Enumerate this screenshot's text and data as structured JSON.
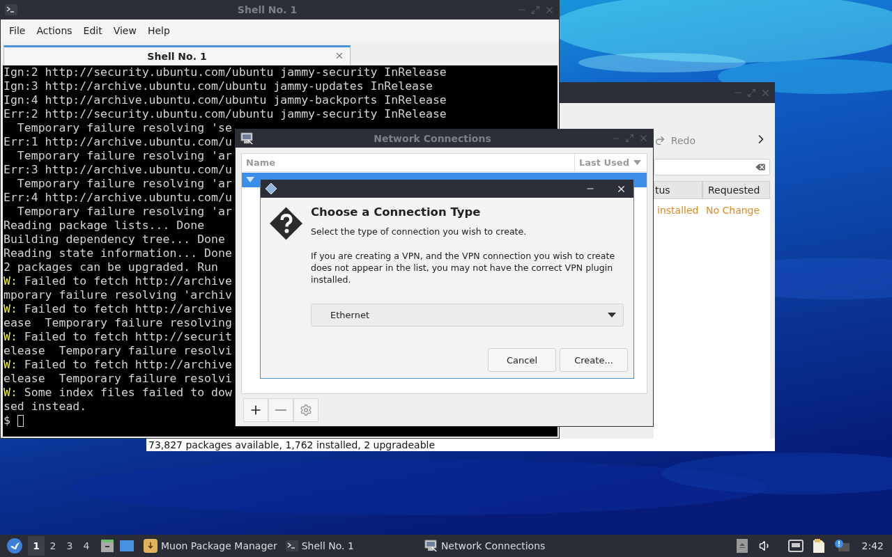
{
  "terminal": {
    "title": "Shell No. 1",
    "menu": [
      "File",
      "Actions",
      "Edit",
      "View",
      "Help"
    ],
    "tabs": [
      {
        "label": "Shell No. 1",
        "selected": true
      }
    ],
    "lines": [
      {
        "text": "Ign:2 http://security.ubuntu.com/ubuntu jammy-security InRelease"
      },
      {
        "text": "Ign:3 http://archive.ubuntu.com/ubuntu jammy-updates InRelease"
      },
      {
        "text": "Ign:4 http://archive.ubuntu.com/ubuntu jammy-backports InRelease"
      },
      {
        "text": "Err:2 http://security.ubuntu.com/ubuntu jammy-security InRelease"
      },
      {
        "text": "  Temporary failure resolving 'se"
      },
      {
        "text": "Err:1 http://archive.ubuntu.com/u"
      },
      {
        "text": "  Temporary failure resolving 'ar"
      },
      {
        "text": "Err:3 http://archive.ubuntu.com/u"
      },
      {
        "text": "  Temporary failure resolving 'ar"
      },
      {
        "text": "Err:4 http://archive.ubuntu.com/u"
      },
      {
        "text": "  Temporary failure resolving 'ar"
      },
      {
        "text": "Reading package lists... Done"
      },
      {
        "text": "Building dependency tree... Done"
      },
      {
        "text": "Reading state information... Done"
      },
      {
        "text": "2 packages can be upgraded. Run"
      },
      {
        "tag": "W:",
        "text": " Failed to fetch http://archive"
      },
      {
        "text": "mporary failure resolving 'archiv"
      },
      {
        "tag": "W:",
        "text": " Failed to fetch http://archive"
      },
      {
        "text": "ease  Temporary failure resolving"
      },
      {
        "tag": "W:",
        "text": " Failed to fetch http://securit"
      },
      {
        "text": "elease  Temporary failure resolvi"
      },
      {
        "tag": "W:",
        "text": " Failed to fetch http://archive"
      },
      {
        "text": "elease  Temporary failure resolvi"
      },
      {
        "tag": "W:",
        "text": " Some index files failed to dow"
      },
      {
        "text": "sed instead."
      }
    ],
    "prompt": "$"
  },
  "package_manager": {
    "toolbar": [
      "Redo"
    ],
    "columns": [
      "tus",
      "Requested"
    ],
    "rows": [
      [
        "installed",
        "No Change"
      ]
    ],
    "status_bar": "73,827 packages available, 1,762 installed, 2 upgradeable"
  },
  "network_connections": {
    "title": "Network Connections",
    "columns": [
      "Name",
      "Last Used"
    ],
    "groups": [
      {
        "expanded": true,
        "selected": true
      }
    ]
  },
  "dialog": {
    "heading": "Choose a Connection Type",
    "subtitle": "Select the type of connection you wish to create.",
    "note": "If you are creating a VPN, and the VPN connection you wish to create does not appear in the list, you may not have the correct VPN plugin installed.",
    "connection_type": "Ethernet",
    "buttons": [
      "Cancel",
      "Create..."
    ]
  },
  "taskbar": {
    "workspaces": [
      {
        "label": "1",
        "selected": true
      },
      {
        "label": "2",
        "selected": false
      },
      {
        "label": "3",
        "selected": false
      },
      {
        "label": "4",
        "selected": false
      }
    ],
    "tasks": [
      {
        "kind": "package",
        "label": "Muon Package Manager"
      },
      {
        "kind": "terminal",
        "label": "Shell No. 1"
      },
      {
        "kind": "network",
        "label": "Network Connections"
      }
    ],
    "clock": "2:42"
  }
}
